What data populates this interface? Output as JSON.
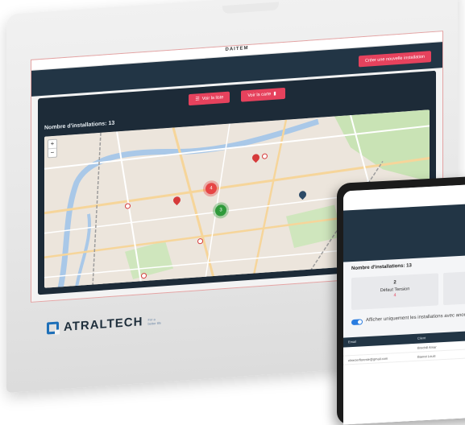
{
  "monitor": {
    "brand": "DAITEM",
    "create_button": "Créer une nouvelle installation",
    "view_list_button": "Voir la liste",
    "view_map_button": "Voir la carte",
    "installations_count": "Nombre d'installations: 13",
    "map": {
      "zoom_in": "+",
      "zoom_out": "−",
      "clusters": [
        {
          "label": "4",
          "color": "#e64545"
        },
        {
          "label": "3",
          "color": "#2f9a3a"
        }
      ]
    }
  },
  "logo": {
    "name": "ATRALTECH",
    "tagline": "For a better life"
  },
  "tablet": {
    "installations_count": "Nombre d'installations: 13",
    "card": {
      "number": "2",
      "label": "Défaut Tension",
      "value": "4"
    },
    "toggle_label": "Afficher uniquement les installations avec anoma",
    "table": {
      "headers": [
        "Email",
        "Client"
      ],
      "rows": [
        {
          "email": "",
          "client": "Brochill Amar"
        },
        {
          "email": "elisezerfloreste@gmail.com",
          "client": "Baeret Louis"
        }
      ]
    }
  },
  "colors": {
    "accent": "#e6425d",
    "navy": "#223545",
    "cluster_red": "#e64545",
    "cluster_green": "#2f9a3a",
    "logo_blue": "#1d6fb8"
  }
}
